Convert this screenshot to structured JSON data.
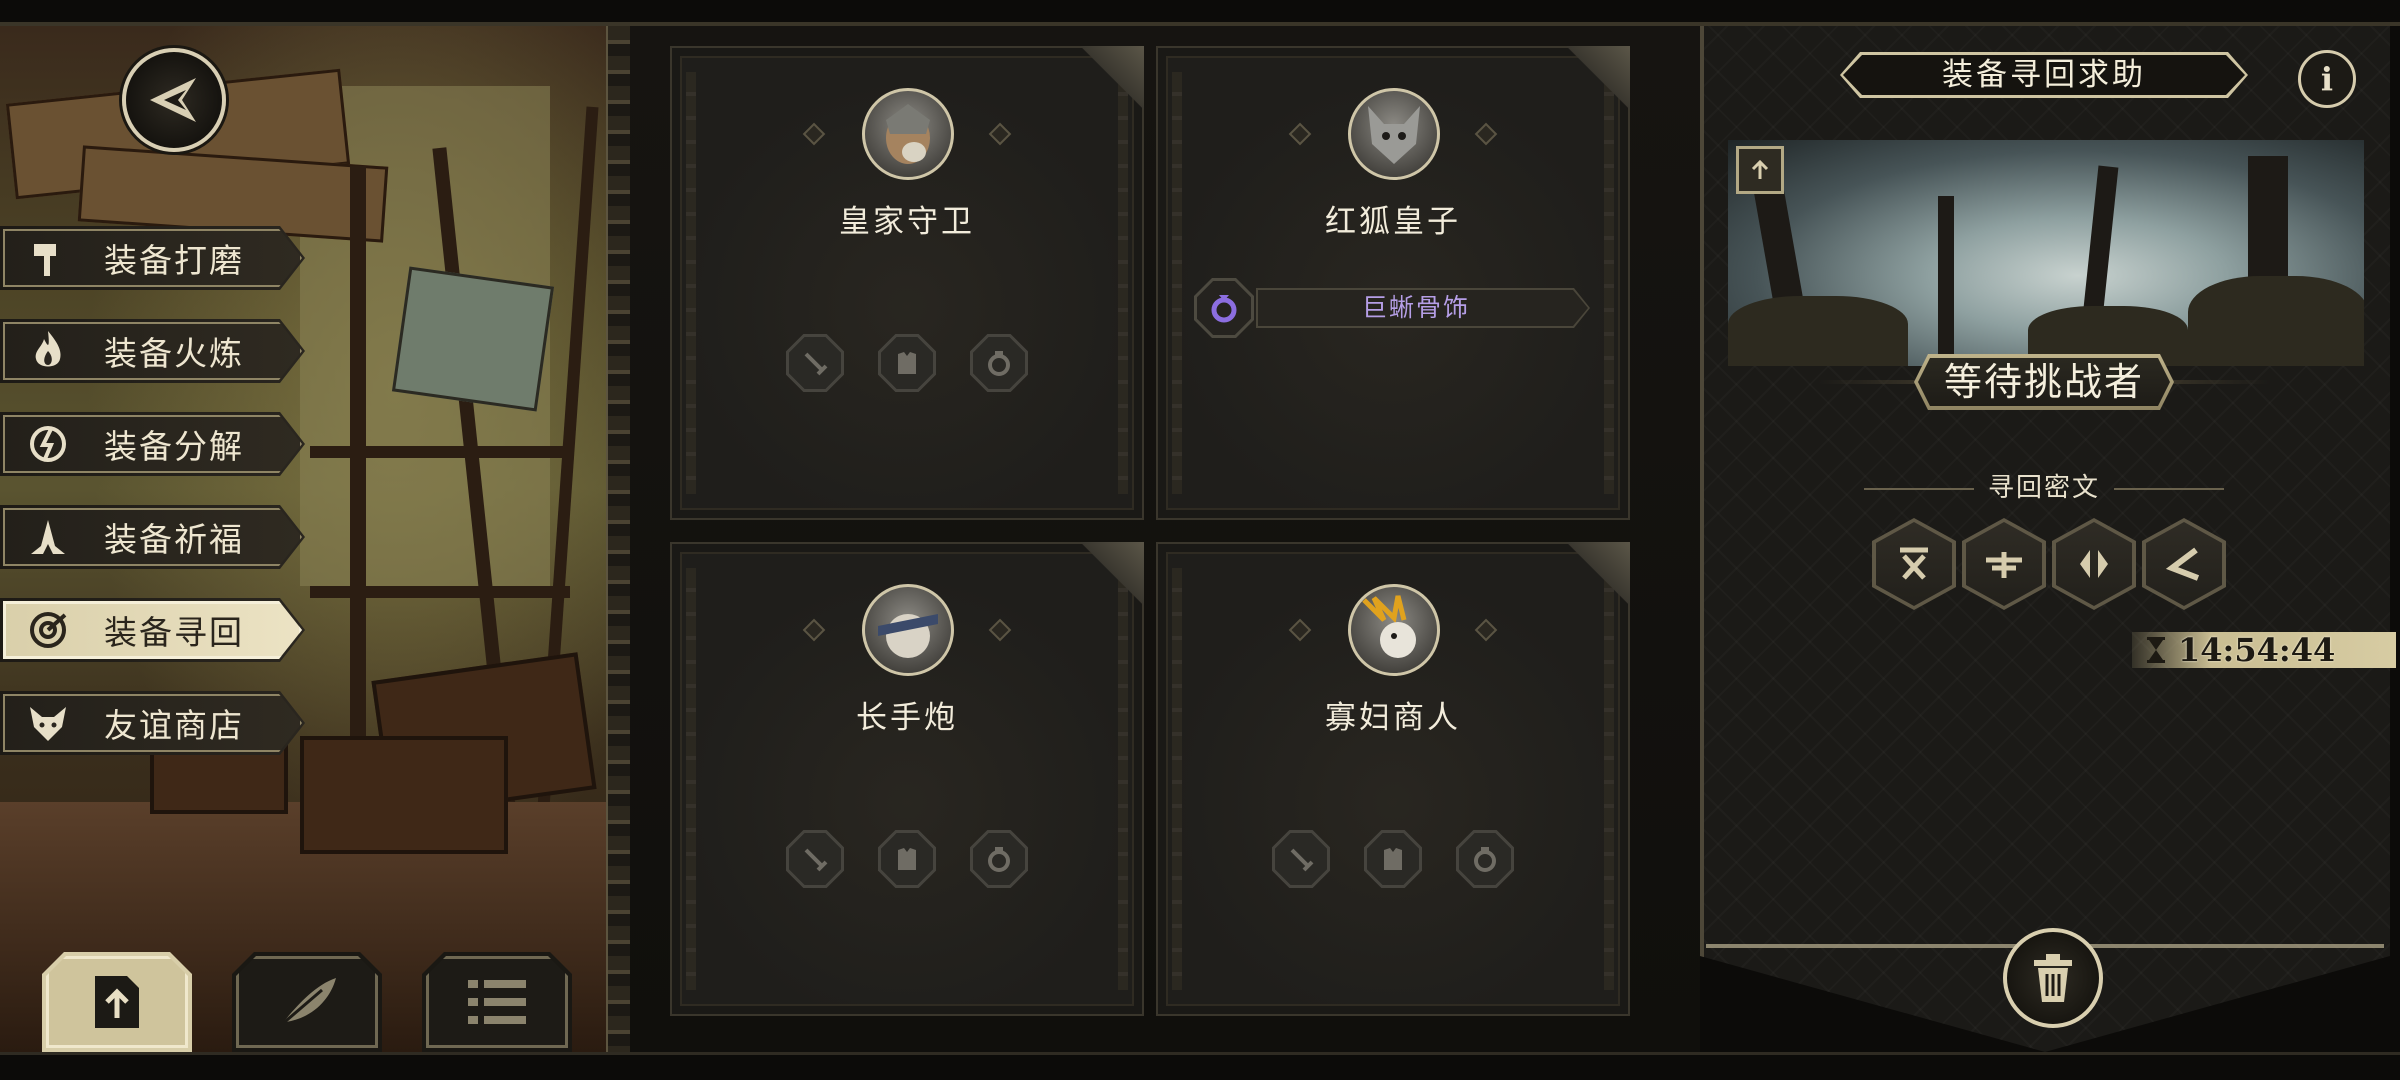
{
  "sidebar": {
    "back_icon": "shuriken-back-icon",
    "menu": [
      {
        "label": "装备打磨",
        "icon": "hammer-icon",
        "active": false
      },
      {
        "label": "装备火炼",
        "icon": "flame-icon",
        "active": false
      },
      {
        "label": "装备分解",
        "icon": "break-icon",
        "active": false
      },
      {
        "label": "装备祈福",
        "icon": "praying-hands-icon",
        "active": false
      },
      {
        "label": "装备寻回",
        "icon": "target-icon",
        "active": true
      },
      {
        "label": "友谊商店",
        "icon": "fox-icon",
        "active": false
      }
    ],
    "bottom_tabs": [
      {
        "icon": "upload-document-icon",
        "active": true
      },
      {
        "icon": "feather-icon",
        "active": false
      },
      {
        "icon": "list-icon",
        "active": false
      }
    ]
  },
  "cards": [
    {
      "name": "皇家守卫",
      "avatar_icon": "royal-guard-avatar",
      "slots": [
        "sword-slot-icon",
        "armor-slot-icon",
        "ring-slot-icon"
      ]
    },
    {
      "name": "红狐皇子",
      "avatar_icon": "red-fox-prince-avatar",
      "item": {
        "name": "巨蜥骨饰",
        "icon": "ring-icon",
        "color": "#b59ee6"
      }
    },
    {
      "name": "长手炮",
      "avatar_icon": "long-arm-cannon-avatar",
      "slots": [
        "sword-slot-icon",
        "armor-slot-icon",
        "ring-slot-icon"
      ]
    },
    {
      "name": "寡妇商人",
      "avatar_icon": "widow-merchant-avatar",
      "slots": [
        "sword-slot-icon",
        "armor-slot-icon",
        "ring-slot-icon"
      ]
    }
  ],
  "panel": {
    "title": "装备寻回求助",
    "info_label": "i",
    "status": "等待挑战者",
    "cipher_label": "寻回密文",
    "runes": [
      "rune-x-icon",
      "rune-bar-icon",
      "rune-split-icon",
      "rune-angle-icon"
    ],
    "timer": "14:54:44",
    "timer_icon": "hourglass-icon",
    "trash_icon": "trash-icon"
  },
  "colors": {
    "accent_gold": "#d8cea9",
    "item_purple": "#b59ee6",
    "panel_bg": "#1b1a17"
  }
}
